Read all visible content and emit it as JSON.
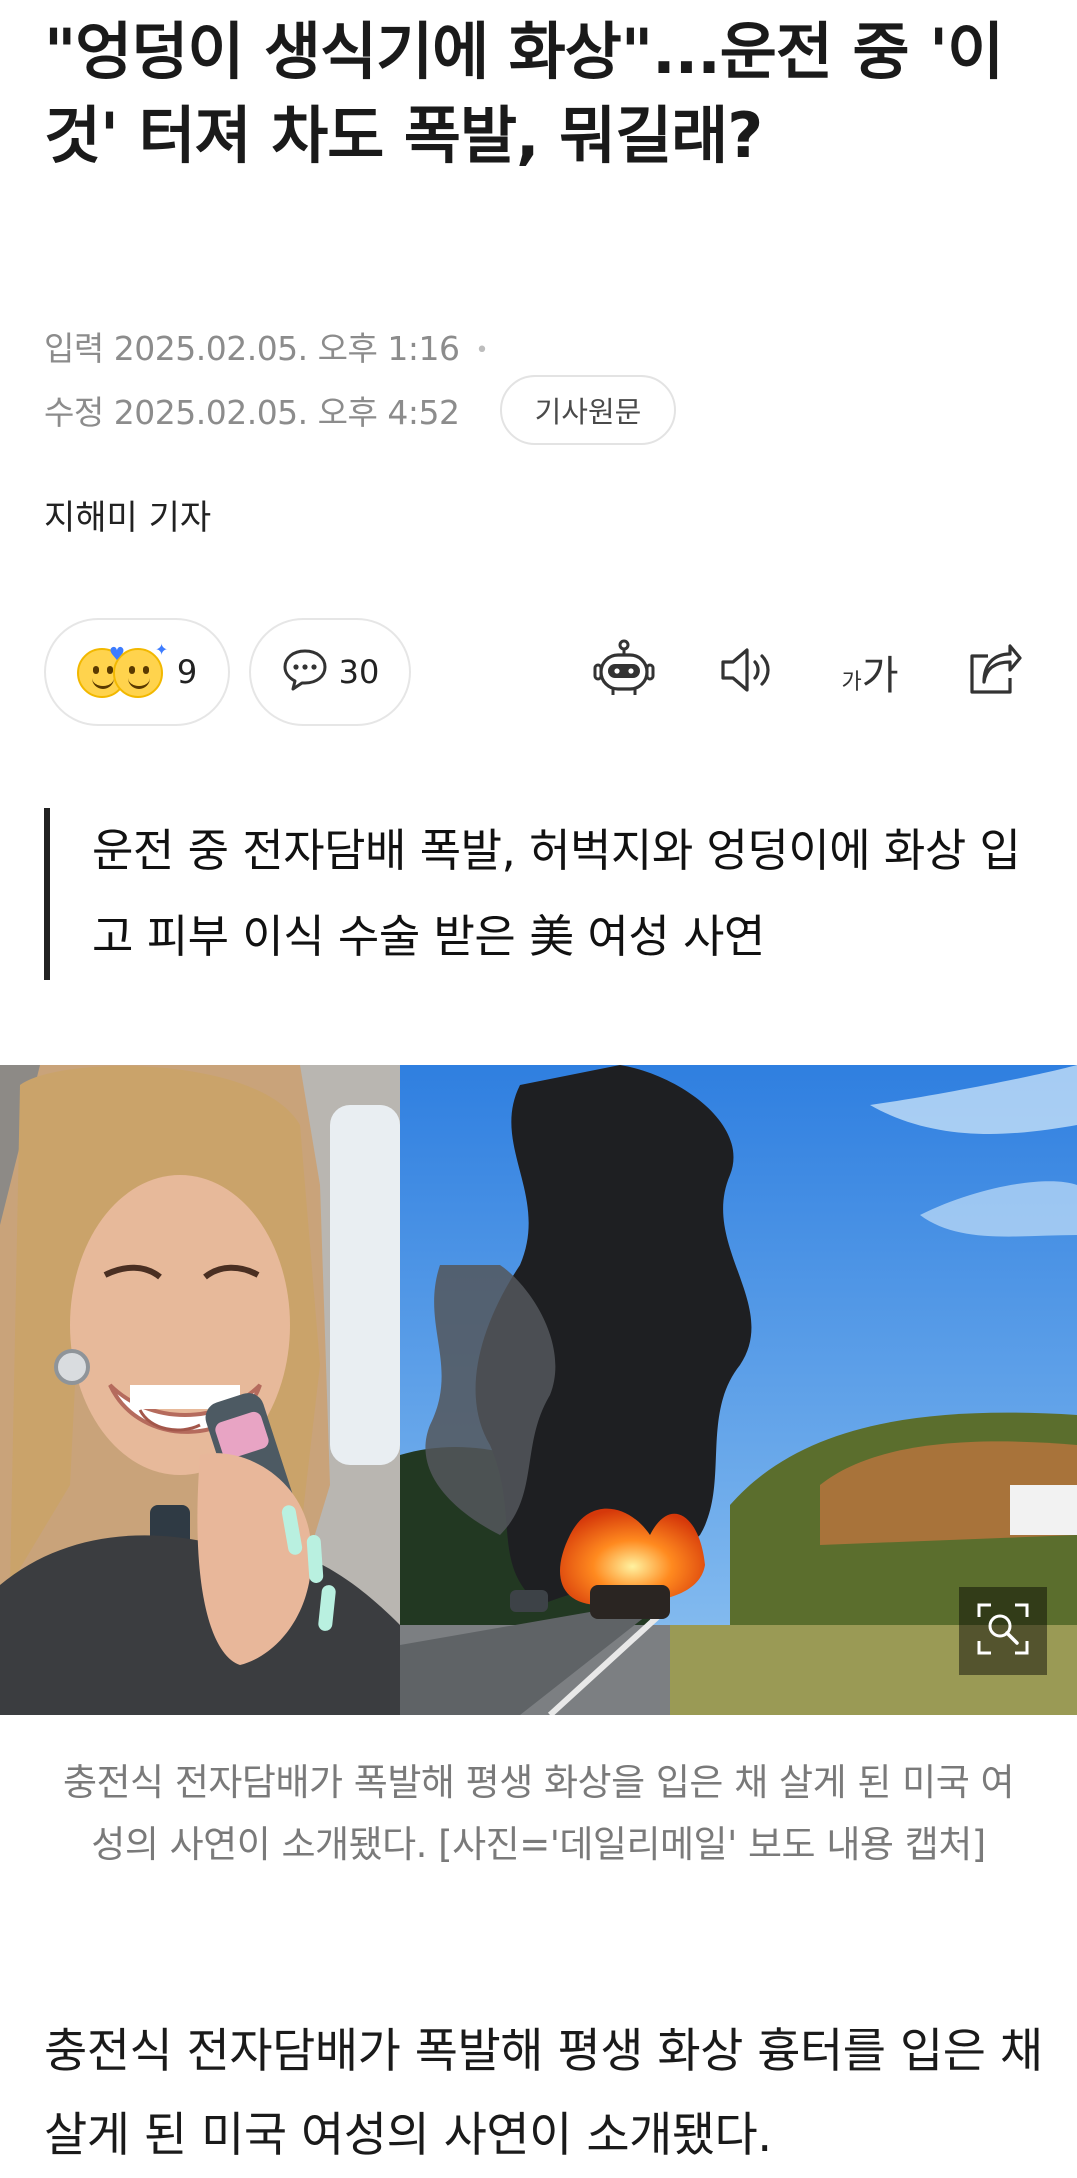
{
  "article": {
    "headline": "\"엉덩이 생식기에 화상\"...운전 중 '이것' 터져 차도 폭발, 뭐길래?",
    "input_label": "입력",
    "input_time": "2025.02.05. 오후 1:16",
    "modified_label": "수정",
    "modified_time": "2025.02.05. 오후 4:52",
    "original_button": "기사원문",
    "reporter": "지해미 기자",
    "summary": "운전 중 전자담배 폭발, 허벅지와 엉덩이에 화상 입고 피부 이식 수술 받은 美 여성 사연",
    "caption": "충전식 전자담배가 폭발해 평생 화상을 입은 채 살게 된 미국 여성의 사연이 소개됐다. [사진='데일리메일' 보도 내용 캡처]",
    "body": "충전식 전자담배가 폭발해 평생 화상 흉터를 입은 채 살게 된 미국 여성의 사연이 소개됐다."
  },
  "actions": {
    "reaction_count": "9",
    "comment_count": "30",
    "font_small": "가",
    "font_big": "가"
  },
  "icons": {
    "reaction": "emoji-faces-icon",
    "comment": "speech-bubble-icon",
    "summary_bot": "robot-icon",
    "tts": "speaker-icon",
    "font_size": "font-size-icon",
    "share": "share-icon",
    "zoom": "zoom-icon"
  }
}
